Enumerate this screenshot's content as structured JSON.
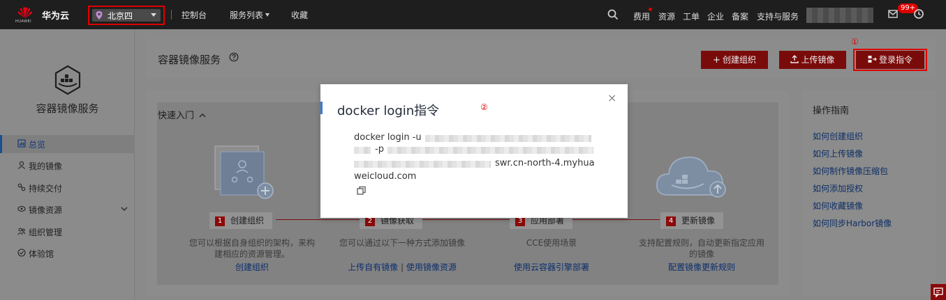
{
  "topbar": {
    "logo_text": "HUAWEI",
    "brand": "华为云",
    "region": "北京四",
    "nav": [
      "控制台",
      "服务列表",
      "收藏"
    ],
    "right": [
      "费用",
      "资源",
      "工单",
      "企业",
      "备案",
      "支持与服务"
    ],
    "badge": "99+"
  },
  "sidebar": {
    "service_title": "容器镜像服务",
    "items": [
      {
        "label": "总览",
        "icon": "overview-icon"
      },
      {
        "label": "我的镜像",
        "icon": "user-icon"
      },
      {
        "label": "持续交付",
        "icon": "delivery-icon"
      },
      {
        "label": "镜像资源",
        "icon": "resource-icon"
      },
      {
        "label": "组织管理",
        "icon": "org-icon"
      },
      {
        "label": "体验馆",
        "icon": "experience-icon"
      }
    ]
  },
  "header": {
    "title": "容器镜像服务",
    "create_org": "创建组织",
    "upload_image": "上传镜像",
    "login_cmd": "登录指令",
    "annotation1": "①"
  },
  "quick_start": {
    "title": "快速入门",
    "steps": [
      {
        "num": "1",
        "label": "创建组织",
        "desc": "您可以根据自身组织的架构，来构建相应的资源管理。",
        "links": [
          "创建组织"
        ]
      },
      {
        "num": "2",
        "label": "镜像获取",
        "desc": "您可以通过以下一种方式添加镜像",
        "links": [
          "上传自有镜像",
          "使用镜像资源"
        ]
      },
      {
        "num": "3",
        "label": "应用部署",
        "desc": "CCE使用场景",
        "links": [
          "使用云容器引擎部署"
        ]
      },
      {
        "num": "4",
        "label": "更新镜像",
        "desc": "支持配置规则，自动更新指定应用的镜像",
        "links": [
          "配置镜像更新规则"
        ]
      }
    ]
  },
  "guide": {
    "title": "操作指南",
    "links": [
      "如何创建组织",
      "如何上传镜像",
      "如何制作镜像压缩包",
      "如何添加授权",
      "如何收藏镜像",
      "如何同步Harbor镜像"
    ]
  },
  "dialog": {
    "title": "docker login指令",
    "close": "×",
    "annotation2": "②",
    "cmd_prefix": "docker login -u",
    "cmd_p": "-p",
    "cmd_host1": "swr.cn-north-4.myhua",
    "cmd_host2": "weicloud.com"
  },
  "colors": {
    "brand_red": "#c7000b",
    "link_blue": "#526ecc",
    "annotation_red": "#e00000"
  }
}
